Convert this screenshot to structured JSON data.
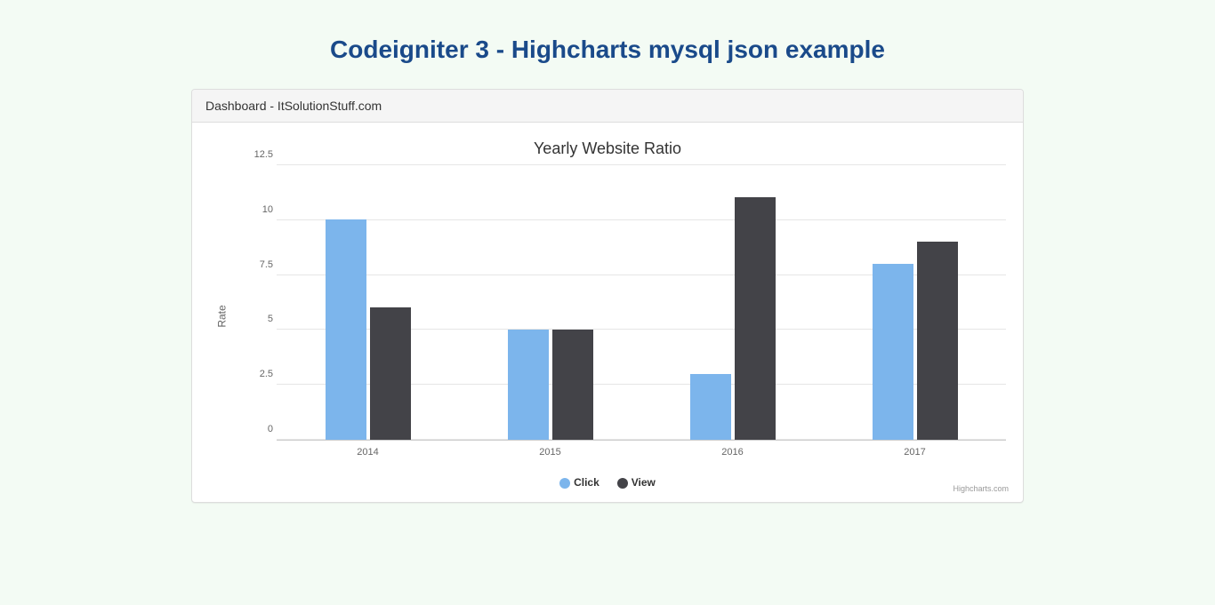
{
  "page_title": "Codeigniter 3 - Highcharts mysql json example",
  "panel_heading": "Dashboard - ItSolutionStuff.com",
  "credits": "Highcharts.com",
  "chart_data": {
    "type": "bar",
    "title": "Yearly Website Ratio",
    "xlabel": "",
    "ylabel": "Rate",
    "categories": [
      "2014",
      "2015",
      "2016",
      "2017"
    ],
    "series": [
      {
        "name": "Click",
        "color": "#7cb5ec",
        "values": [
          10,
          5,
          3,
          8
        ]
      },
      {
        "name": "View",
        "color": "#434348",
        "values": [
          6,
          5,
          11,
          9
        ]
      }
    ],
    "ylim": [
      0,
      12.5
    ],
    "y_ticks": [
      0,
      2.5,
      5,
      7.5,
      10,
      12.5
    ]
  }
}
